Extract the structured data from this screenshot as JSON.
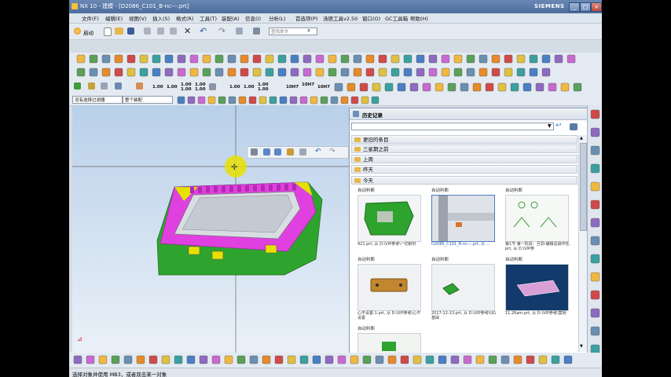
{
  "window": {
    "title": "NX 10 - 建模 - [D2086_C101_B-nc---.prt]",
    "brand": "SIEMENS",
    "controls": [
      "_",
      "□",
      "×"
    ]
  },
  "menu": [
    "文件(F)",
    "编辑(E)",
    "视图(V)",
    "插入(S)",
    "格式(R)",
    "工具(T)",
    "装配(A)",
    "信息(I)",
    "分析(L)",
    "首选项(P)",
    "汤德工具v2.50",
    "窗口(O)",
    "GC工具箱",
    "帮助(H)"
  ],
  "toolbar": {
    "start_label": "启动",
    "command_search_placeholder": "查找命令",
    "dimension_buttons": [
      "1.00",
      "1.00",
      "1.00\n1.00",
      "1.00\n1.00",
      "1.00",
      "1.00",
      "1.00",
      "1.00"
    ],
    "letter_buttons": [
      "10H7",
      "10H7",
      "10H7"
    ]
  },
  "selection": {
    "filter_value": "没有选择过滤器",
    "scope_value": "整个装配"
  },
  "history": {
    "title": "历史记录",
    "groups": [
      "更旧的条目",
      "三星期之前",
      "上周",
      "昨天",
      "今天"
    ],
    "tiles": [
      {
        "label": "自动判断",
        "caption": "421.prt, 从 D:\\VIP参考\\一切射针",
        "selected": false
      },
      {
        "label": "自动判断",
        "caption": "D2086_C101_B-nc---.prt, 从 ...",
        "selected": true
      },
      {
        "label": "自动判断",
        "caption": "第1节 第一阶段：旦调-编辑总操作任.prt, 从 D:\\VIP参",
        "selected": false
      },
      {
        "label": "自动判断",
        "caption": "心不设置-1.prt, 从 D:\\VIP参考\\心不设置",
        "selected": false
      },
      {
        "label": "自动判断",
        "caption": "2017-12-13.prt, 从 D:\\VIP参考\\UG基础",
        "selected": false
      },
      {
        "label": "自动判断",
        "caption": "11.26am.prt, 从 D:\\VIP参考\\案例",
        "selected": false
      },
      {
        "label": "自动判断",
        "caption": "",
        "selected": false
      }
    ]
  },
  "status": {
    "text": "选择对象并使用 MB3，或者双击某一对象"
  },
  "colors": {
    "title_bar": "#4d6d9e",
    "model_magenta": "#e040e0",
    "model_green": "#2ea42e",
    "model_yellow": "#e8e000",
    "selection_blue": "#4b79c0"
  }
}
